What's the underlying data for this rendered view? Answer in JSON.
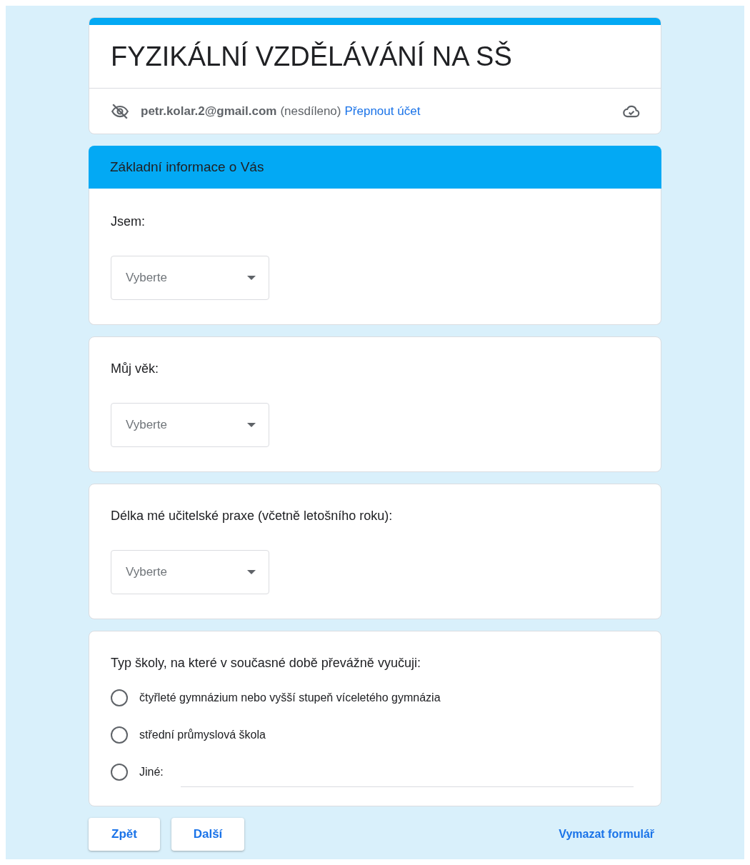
{
  "form": {
    "title": "FYZIKÁLNÍ VZDĚLÁVÁNÍ NA SŠ",
    "account": {
      "email": "petr.kolar.2@gmail.com",
      "note": "(nesdíleno)",
      "switch_link": "Přepnout účet"
    }
  },
  "section": {
    "title": "Základní informace o Vás"
  },
  "questions": [
    {
      "kind": "dropdown",
      "label": "Jsem:",
      "placeholder": "Vyberte"
    },
    {
      "kind": "dropdown",
      "label": "Můj věk:",
      "placeholder": "Vyberte"
    },
    {
      "kind": "dropdown",
      "label": "Délka mé učitelské praxe (včetně letošního roku):",
      "placeholder": "Vyberte"
    },
    {
      "kind": "radio",
      "label": "Typ školy, na které v současné době převážně vyučuji:",
      "options": [
        {
          "kind": "choice",
          "label": "čtyřleté gymnázium nebo vyšší stupeň víceletého gymnázia",
          "selected": false
        },
        {
          "kind": "choice",
          "label": "střední průmyslová škola",
          "selected": false
        },
        {
          "kind": "other",
          "label": "Jiné:",
          "selected": false
        }
      ]
    }
  ],
  "buttons": [
    {
      "label": "Zpět"
    },
    {
      "label": "Další"
    }
  ],
  "clear_link": "Vymazat formulář"
}
